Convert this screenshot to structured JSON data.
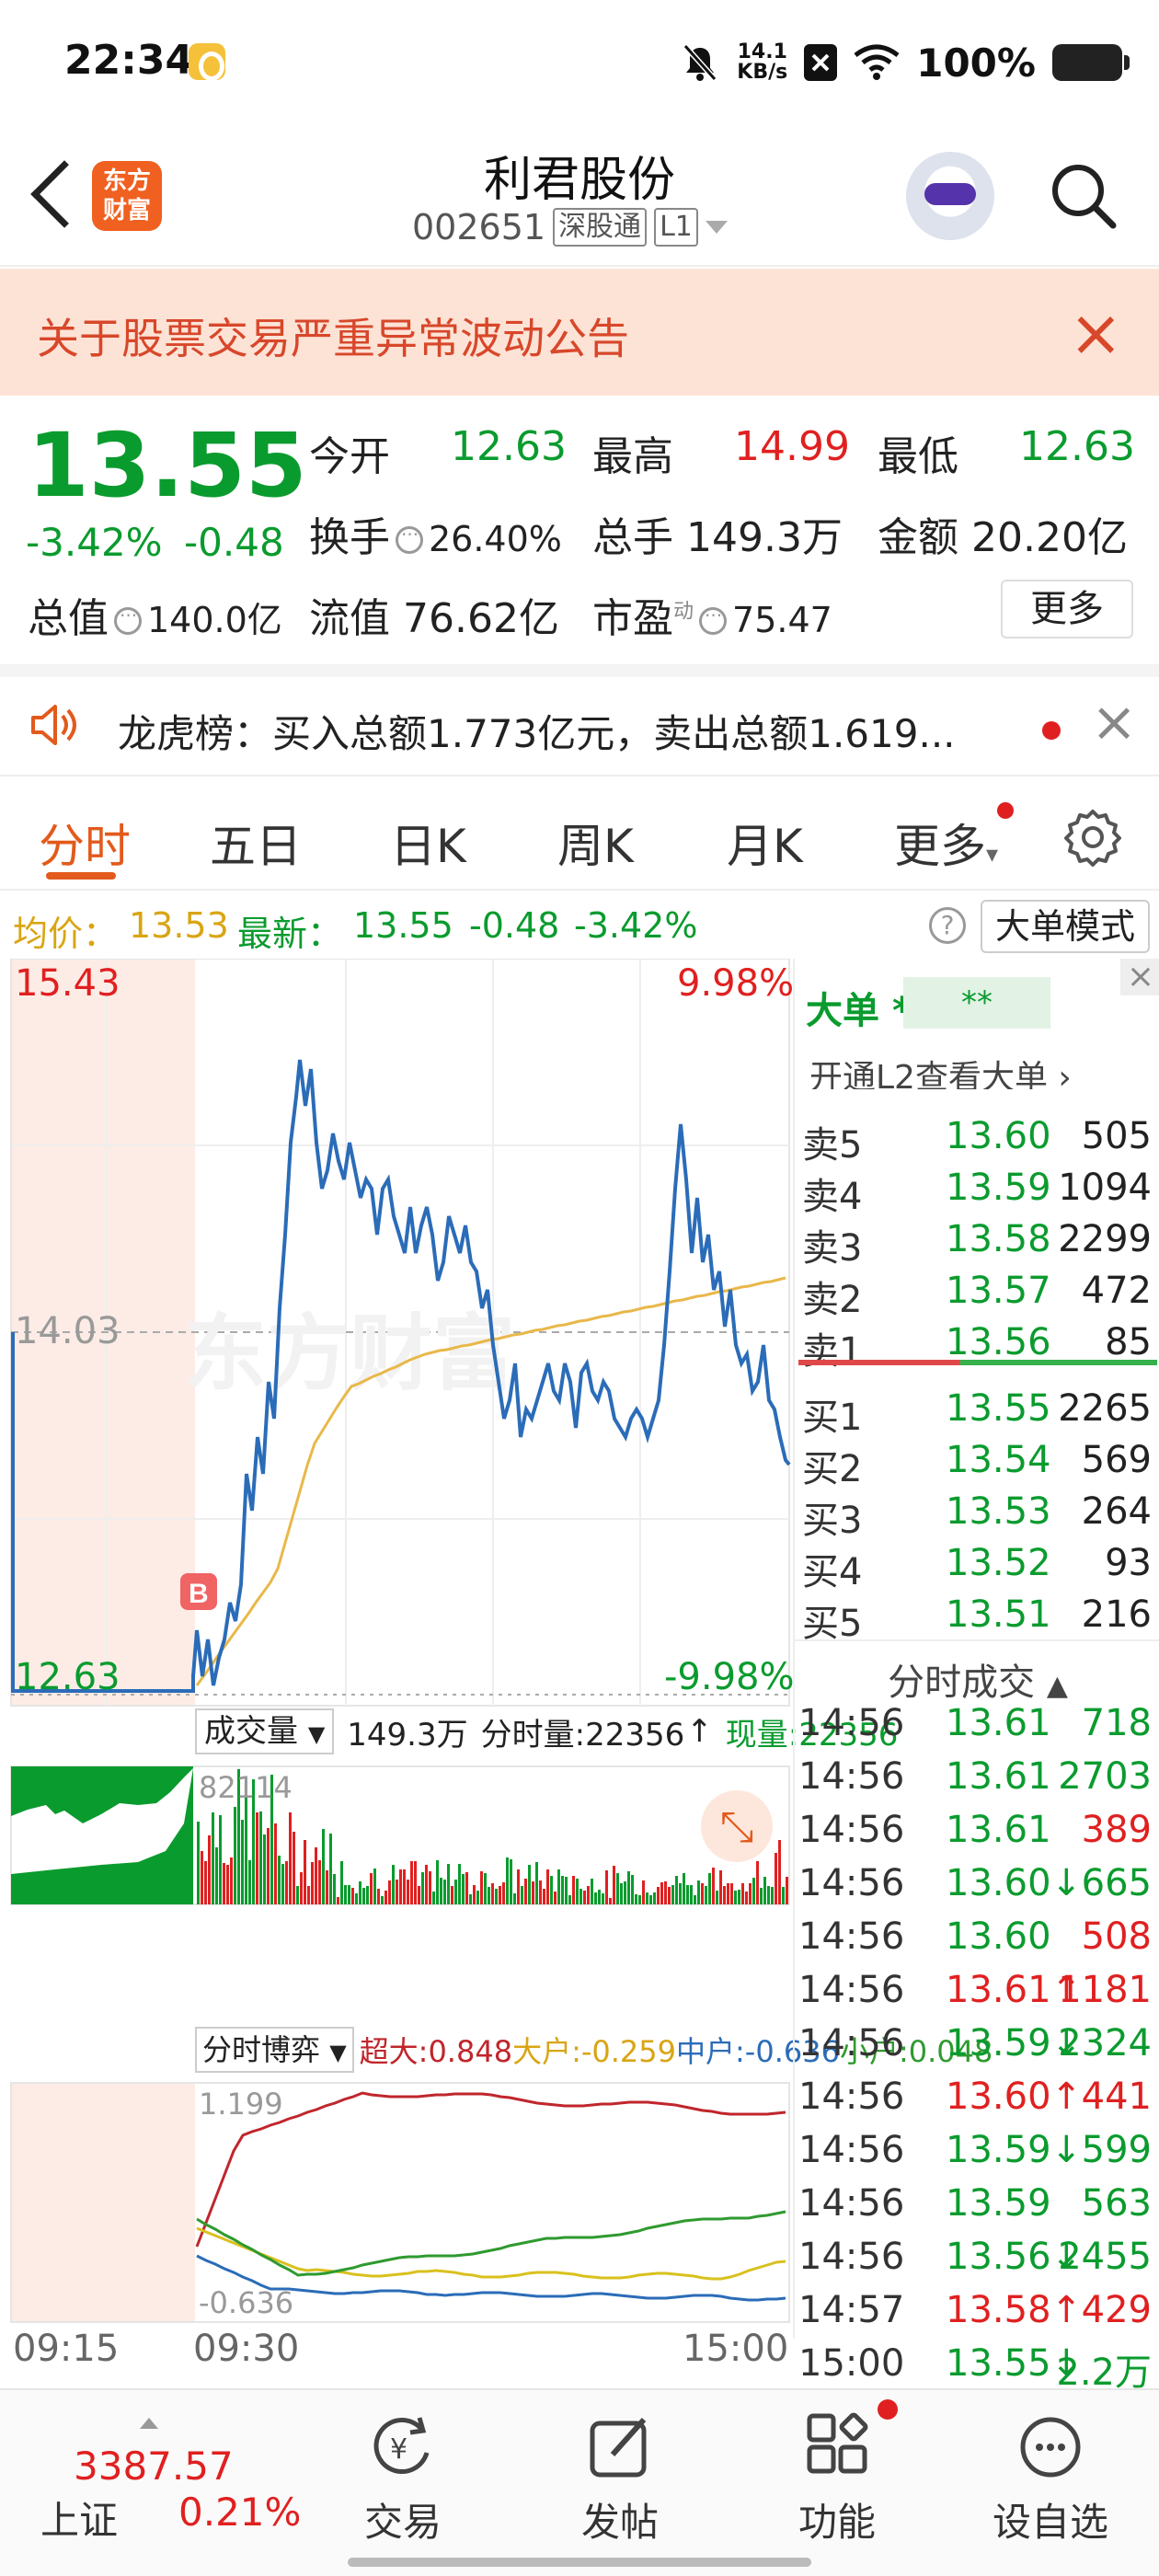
{
  "status_bar": {
    "time": "22:34",
    "speed_top": "14.1",
    "speed_bottom": "KB/s",
    "battery": "100%"
  },
  "header": {
    "logo_line1": "东方",
    "logo_line2": "财富",
    "stock_name": "利君股份",
    "stock_code": "002651",
    "tag1": "深股通",
    "tag2": "L1"
  },
  "notice": {
    "text": "关于股票交易严重异常波动公告",
    "close": "×"
  },
  "quote": {
    "price": "13.55",
    "change_pct": "-3.42%",
    "change_abs": "-0.48",
    "open_label": "今开",
    "open_value": "12.63",
    "high_label": "最高",
    "high_value": "14.99",
    "low_label": "最低",
    "low_value": "12.63",
    "turnover_label": "换手",
    "turnover_value": "26.40%",
    "volume_label": "总手",
    "volume_value": "149.3万",
    "amount_label": "金额",
    "amount_value": "20.20亿",
    "mktcap_label": "总值",
    "mktcap_value": "140.0亿",
    "float_label": "流值",
    "float_value": "76.62亿",
    "pe_label": "市盈",
    "pe_sup": "动",
    "pe_value": "75.47",
    "more_button": "更多"
  },
  "lhb": {
    "text": "龙虎榜：买入总额1.773亿元，卖出总额1.619...",
    "close": "×"
  },
  "tabs": [
    "分时",
    "五日",
    "日K",
    "周K",
    "月K",
    "更多"
  ],
  "avg_row": {
    "avg_label": "均价：",
    "avg_value": "13.53",
    "latest_label": "最新：",
    "latest_value": "13.55",
    "latest_change": "-0.48",
    "latest_pct": "-3.42%",
    "help": "?",
    "mode_button": "大单模式"
  },
  "chart": {
    "top_price": "15.43",
    "top_pct": "9.98%",
    "mid_price": "14.03",
    "bottom_price": "12.63",
    "bottom_pct": "-9.98%",
    "marker": "B",
    "watermark": "东方财富",
    "vol_label": "成交量",
    "vol_total": "149.3万",
    "vol_tick_label": "分时量:22356",
    "vol_now_label": "现量:22356",
    "vol_max": "82114",
    "game_label": "分时博弈",
    "game_super": "超大:0.848",
    "game_big": "大户:-0.259",
    "game_mid": "中户:-0.636",
    "game_small": "小户:0.048",
    "game_max": "1.199",
    "game_min": "-0.636",
    "time_start": "09:15",
    "time_open": "09:30",
    "time_end": "15:00",
    "colors": {
      "price_line": "#2b6cb8",
      "avg_line": "#e8b84a",
      "up": "#e02020",
      "down": "#0a9b2e"
    }
  },
  "book": {
    "big_order_label": "大单",
    "big_order_stars": "**",
    "big_order_box": "**",
    "l2_link": "开通L2查看大单 ›",
    "asks": [
      {
        "name": "卖5",
        "price": "13.60",
        "qty": "505"
      },
      {
        "name": "卖4",
        "price": "13.59",
        "qty": "1094"
      },
      {
        "name": "卖3",
        "price": "13.58",
        "qty": "2299"
      },
      {
        "name": "卖2",
        "price": "13.57",
        "qty": "472"
      },
      {
        "name": "卖1",
        "price": "13.56",
        "qty": "85"
      }
    ],
    "bids": [
      {
        "name": "买1",
        "price": "13.55",
        "qty": "2265"
      },
      {
        "name": "买2",
        "price": "13.54",
        "qty": "569"
      },
      {
        "name": "买3",
        "price": "13.53",
        "qty": "264"
      },
      {
        "name": "买4",
        "price": "13.52",
        "qty": "93"
      },
      {
        "name": "买5",
        "price": "13.51",
        "qty": "216"
      }
    ],
    "ticks_title": "分时成交",
    "ticks": [
      {
        "time": "14:56",
        "price": "13.61",
        "vol": "718",
        "dir": "none",
        "color": "green"
      },
      {
        "time": "14:56",
        "price": "13.61",
        "vol": "2703",
        "dir": "none",
        "color": "green"
      },
      {
        "time": "14:56",
        "price": "13.61",
        "vol": "389",
        "dir": "none",
        "color": "red"
      },
      {
        "time": "14:56",
        "price": "13.60↓",
        "vol": "665",
        "dir": "down",
        "color": "green"
      },
      {
        "time": "14:56",
        "price": "13.60",
        "vol": "508",
        "dir": "none",
        "color": "red"
      },
      {
        "time": "14:56",
        "price": "13.61↑",
        "vol": "1181",
        "dir": "up",
        "color": "red"
      },
      {
        "time": "14:56",
        "price": "13.59↓",
        "vol": "2324",
        "dir": "down",
        "color": "green"
      },
      {
        "time": "14:56",
        "price": "13.60↑",
        "vol": "441",
        "dir": "up",
        "color": "red"
      },
      {
        "time": "14:56",
        "price": "13.59↓",
        "vol": "599",
        "dir": "down",
        "color": "green"
      },
      {
        "time": "14:56",
        "price": "13.59",
        "vol": "563",
        "dir": "none",
        "color": "green"
      },
      {
        "time": "14:56",
        "price": "13.56↓",
        "vol": "2455",
        "dir": "down",
        "color": "green"
      },
      {
        "time": "14:57",
        "price": "13.58↑",
        "vol": "429",
        "dir": "up",
        "color": "red"
      },
      {
        "time": "15:00",
        "price": "13.55↓",
        "vol": "2.2万",
        "dir": "down",
        "color": "green"
      }
    ]
  },
  "bottom_bar": {
    "index_value": "3387.57",
    "index_name": "上证",
    "index_change": "0.21%",
    "items": [
      "交易",
      "发帖",
      "功能",
      "设自选"
    ],
    "icons": [
      "trade-icon",
      "post-icon",
      "function-icon",
      "watchlist-icon"
    ]
  }
}
